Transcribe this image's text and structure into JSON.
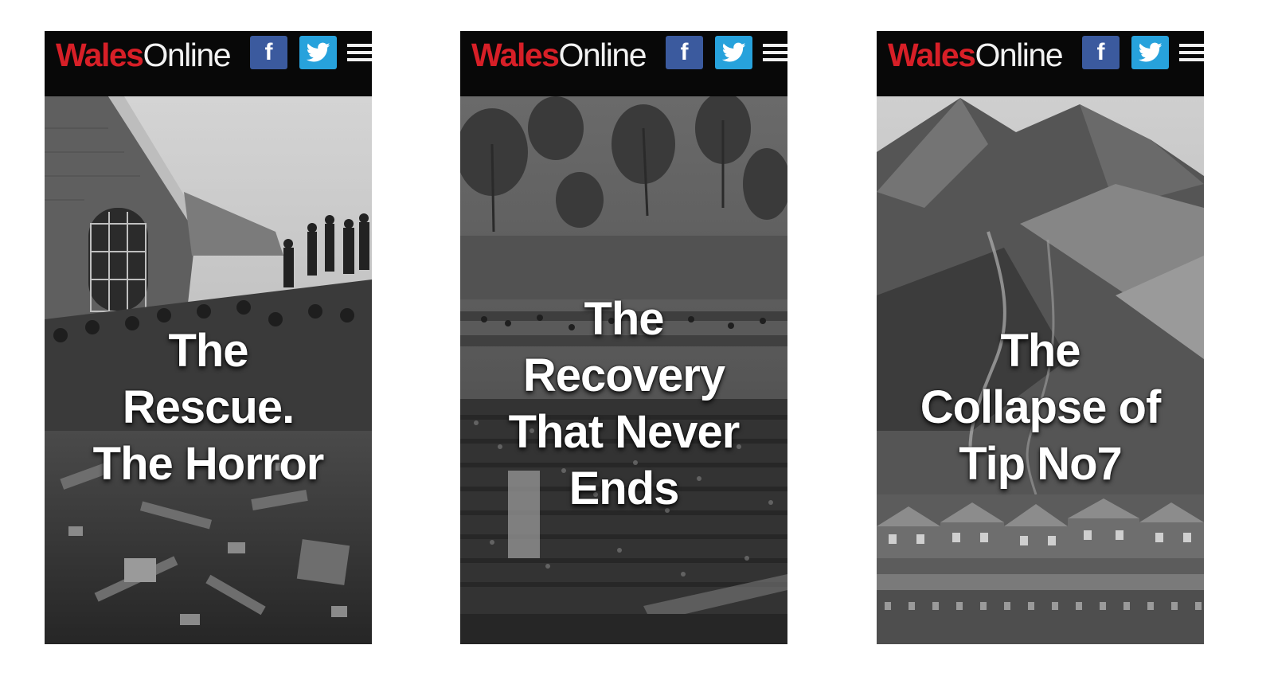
{
  "brand": {
    "wales": "Wales",
    "online": "Online",
    "wales_color": "#d71f27",
    "facebook_glyph": "f",
    "facebook_color": "#3b5a9e",
    "twitter_color": "#27a2dc"
  },
  "panels": [
    {
      "headline": [
        "The",
        "Rescue.",
        "The Horror"
      ]
    },
    {
      "headline": [
        "The",
        "Recovery",
        "That Never",
        "Ends"
      ]
    },
    {
      "headline": [
        "The",
        "Collapse of",
        "Tip No7"
      ]
    }
  ]
}
